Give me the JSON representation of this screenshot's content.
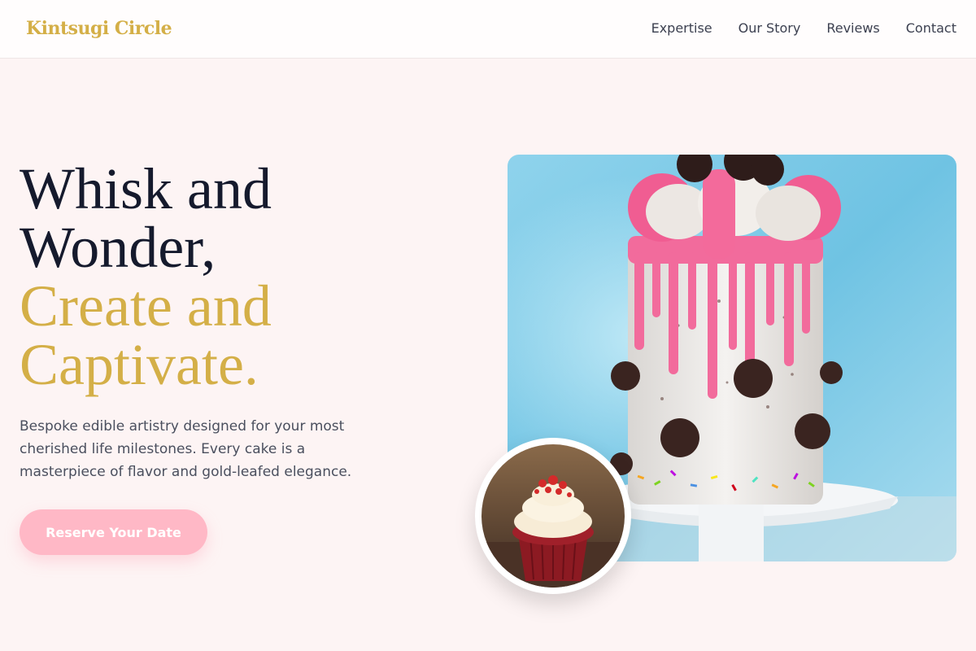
{
  "brand": {
    "name": "Kintsugi Circle",
    "accent_color": "#d4af47"
  },
  "nav": {
    "items": [
      {
        "label": "Expertise"
      },
      {
        "label": "Our Story"
      },
      {
        "label": "Reviews"
      },
      {
        "label": "Contact"
      }
    ]
  },
  "hero": {
    "headline_line1": "Whisk and",
    "headline_line2": "Wonder,",
    "headline_line3": "Create and",
    "headline_line4": "Captivate.",
    "description": "Bespoke edible artistry designed for your most cherished life milestones. Every cake is a masterpiece of flavor and gold-leafed elegance.",
    "cta_label": "Reserve Your Date",
    "cta_color": "#ffb8c6",
    "main_image": "drip-cake-photo",
    "thumb_image": "red-velvet-cupcake-photo"
  }
}
